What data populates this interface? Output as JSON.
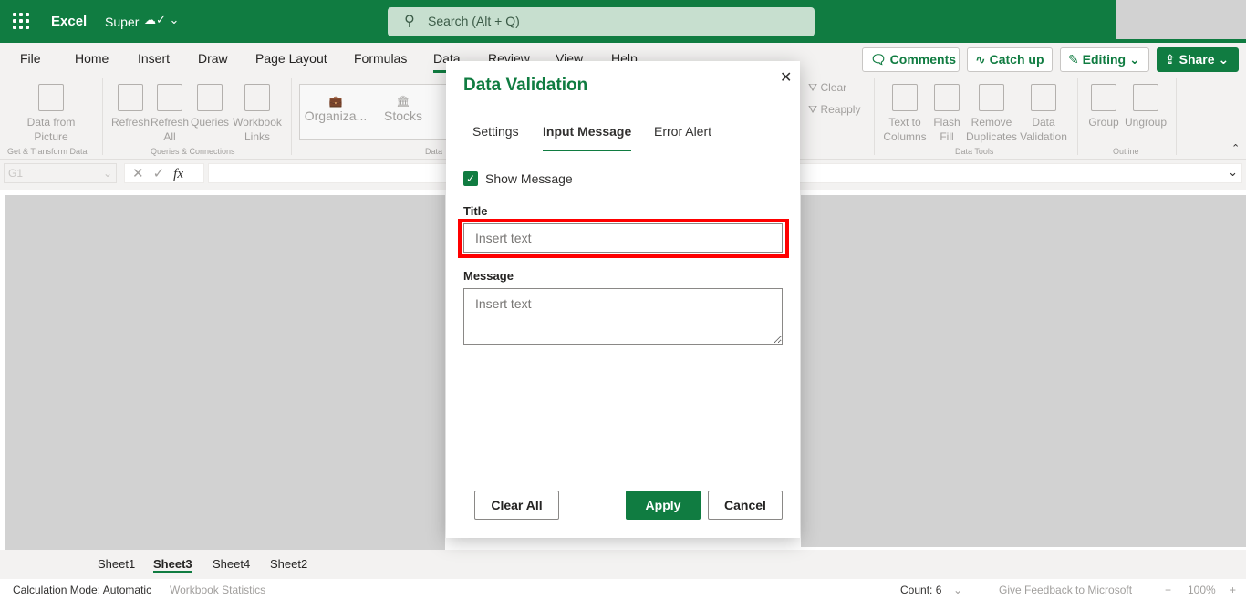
{
  "header": {
    "app_name": "Excel",
    "doc_name": "Super",
    "doc_status_icon": "cloud-saved-icon",
    "search_placeholder": "Search (Alt + Q)"
  },
  "ribbon_tabs": [
    "File",
    "Home",
    "Insert",
    "Draw",
    "Page Layout",
    "Formulas",
    "Data",
    "Review",
    "View",
    "Help"
  ],
  "active_tab": "Data",
  "top_buttons": {
    "comments": "Comments",
    "catch_up": "Catch up",
    "editing": "Editing",
    "share": "Share"
  },
  "ribbon": {
    "data_from_picture": "Data from Picture",
    "refresh": "Refresh",
    "refresh_all": "Refresh All",
    "queries": "Queries",
    "workbook_links": "Workbook Links",
    "organization": "Organiza...",
    "stocks": "Stocks",
    "clear": "Clear",
    "reapply": "Reapply",
    "text_to_columns": "Text to Columns",
    "flash_fill": "Flash Fill",
    "remove_duplicates": "Remove Duplicates",
    "data_validation": "Data Validation",
    "group": "Group",
    "ungroup": "Ungroup",
    "groups": {
      "get_transform": "Get & Transform Data",
      "queries_connections": "Queries & Connections",
      "data_types": "Data",
      "data_tools": "Data Tools",
      "outline": "Outline"
    }
  },
  "formula_bar": {
    "name_box": "G1",
    "fx": "fx",
    "value": ""
  },
  "sheets": [
    "Sheet1",
    "Sheet3",
    "Sheet4",
    "Sheet2"
  ],
  "active_sheet": "Sheet3",
  "status": {
    "calc_mode": "Calculation Mode: Automatic",
    "workbook_stats": "Workbook Statistics",
    "count": "Count: 6",
    "feedback": "Give Feedback to Microsoft",
    "zoom": "100%"
  },
  "dialog": {
    "title": "Data Validation",
    "tabs": [
      "Settings",
      "Input Message",
      "Error Alert"
    ],
    "active_tab": "Input Message",
    "show_message_label": "Show Message",
    "show_message_checked": true,
    "title_label": "Title",
    "title_value": "",
    "title_placeholder": "Insert text",
    "message_label": "Message",
    "message_value": "",
    "message_placeholder": "Insert text",
    "clear_all": "Clear All",
    "apply": "Apply",
    "cancel": "Cancel"
  },
  "colors": {
    "brand": "#107c41",
    "highlight": "#ff0000"
  }
}
